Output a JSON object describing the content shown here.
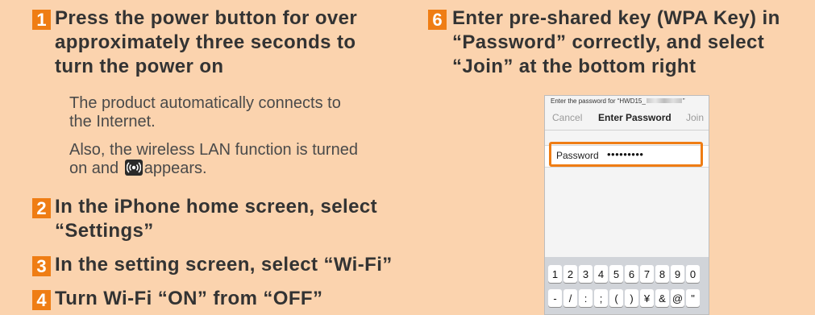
{
  "steps": [
    {
      "number": "1",
      "heading_lines": [
        "Press the power button for over",
        "approximately three seconds to",
        "turn the power on"
      ],
      "paragraphs": [
        {
          "lines": [
            "The product automatically connects to",
            "the Internet."
          ]
        },
        {
          "lines": [
            "Also, the wireless LAN function is turned",
            "on and",
            "appears."
          ]
        }
      ]
    },
    {
      "number": "2",
      "heading_lines": [
        "In the iPhone home screen, select",
        "“Settings”"
      ]
    },
    {
      "number": "3",
      "heading_lines": [
        "In the setting screen, select “Wi-Fi”"
      ]
    },
    {
      "number": "4",
      "heading_lines": [
        "Turn Wi-Fi “ON” from “OFF”"
      ]
    },
    {
      "number": "6",
      "heading_lines": [
        "Enter pre-shared key (WPA Key) in",
        "“Password” correctly, and select",
        "“Join” at the bottom right"
      ]
    }
  ],
  "phone": {
    "prompt_prefix": "Enter the password for “HWD15_",
    "prompt_suffix": "”",
    "cancel": "Cancel",
    "title": "Enter Password",
    "join": "Join",
    "field_label": "Password",
    "field_value": "•••••••••",
    "keyboard_row1": [
      "1",
      "2",
      "3",
      "4",
      "5",
      "6",
      "7",
      "8",
      "9",
      "0"
    ],
    "keyboard_row2": [
      "-",
      "/",
      ":",
      ";",
      "(",
      ")",
      "¥",
      "&",
      "@",
      "\""
    ]
  },
  "colors": {
    "background": "#fbd3ae",
    "accent": "#ef7d14"
  },
  "icons": {
    "wireless_lan": "wireless-lan-icon"
  }
}
